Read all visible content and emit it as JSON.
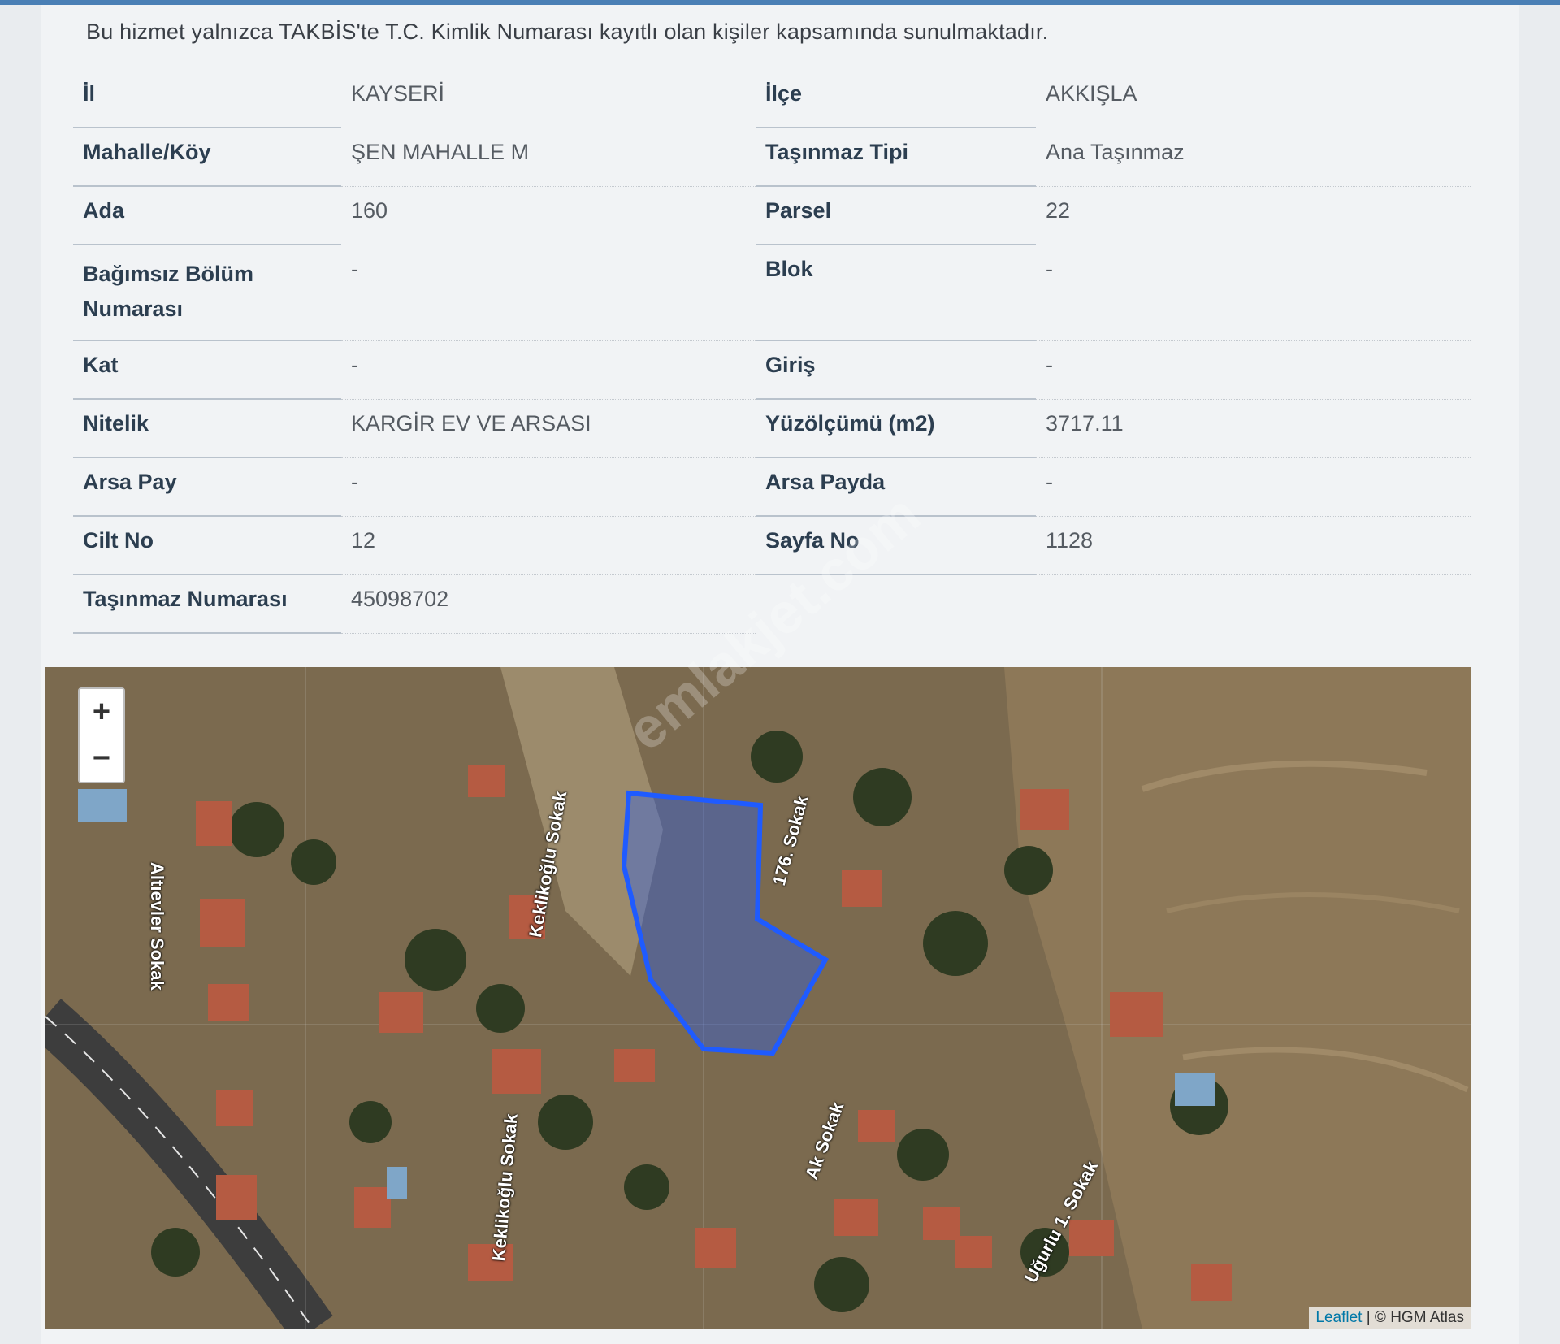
{
  "notice": "Bu hizmet yalnızca TAKBİS'te T.C. Kimlik Numarası kayıtlı olan kişiler kapsamında sunulmaktadır.",
  "rows": [
    {
      "l1": "İl",
      "v1": "KAYSERİ",
      "l2": "İlçe",
      "v2": "AKKIŞLA"
    },
    {
      "l1": "Mahalle/Köy",
      "v1": "ŞEN MAHALLE M",
      "l2": "Taşınmaz Tipi",
      "v2": "Ana Taşınmaz"
    },
    {
      "l1": "Ada",
      "v1": "160",
      "l2": "Parsel",
      "v2": "22"
    },
    {
      "l1": "Bağımsız Bölüm Numarası",
      "v1": "-",
      "l2": "Blok",
      "v2": "-"
    },
    {
      "l1": "Kat",
      "v1": "-",
      "l2": "Giriş",
      "v2": "-"
    },
    {
      "l1": "Nitelik",
      "v1": "KARGİR EV VE ARSASI",
      "l2": "Yüzölçümü (m2)",
      "v2": "3717.11"
    },
    {
      "l1": "Arsa Pay",
      "v1": "-",
      "l2": "Arsa Payda",
      "v2": "-"
    },
    {
      "l1": "Cilt No",
      "v1": "12",
      "l2": "Sayfa No",
      "v2": "1128"
    },
    {
      "l1": "Taşınmaz Numarası",
      "v1": "45098702",
      "l2": "",
      "v2": ""
    }
  ],
  "map": {
    "zoom_in": "+",
    "zoom_out": "−",
    "attribution_leaflet": "Leaflet",
    "attribution_sep": " | ",
    "attribution_source": "© HGM Atlas",
    "streets": {
      "altievler": "Altıevler Sokak",
      "keklikoglu_upper": "Keklikoğlu Sokak",
      "keklikoglu_lower": "Keklikoğlu Sokak",
      "sokak176": "176. Sokak",
      "ak": "Ak Sokak",
      "ugurlu": "Uğurlu 1. Sokak"
    },
    "watermark": "emlakjet.com",
    "parcel_color": "#1f5bff"
  }
}
